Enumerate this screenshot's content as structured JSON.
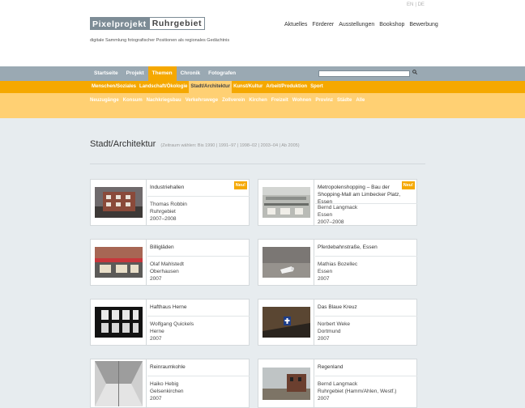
{
  "header": {
    "lang_links": [
      "EN",
      "DE"
    ],
    "logo_part1": "Pixelprojekt",
    "logo_part2": "Ruhrgebiet",
    "tagline": "digitale Sammlung fotografischer Positionen als regionales Gedächtnis",
    "top_nav": [
      "Aktuelles",
      "Förderer",
      "Ausstellungen",
      "Bookshop",
      "Bewerbung"
    ]
  },
  "nav_main": {
    "items": [
      "Startseite",
      "Projekt",
      "Themen",
      "Chronik",
      "Fotografen"
    ],
    "active": "Themen"
  },
  "search": {
    "placeholder": ""
  },
  "nav_themes": {
    "items": [
      "Menschen/Soziales",
      "Landschaft/Ökologie",
      "Stadt/Architektur",
      "Kunst/Kultur",
      "Arbeit/Produktion",
      "Sport"
    ],
    "active": "Stadt/Architektur"
  },
  "nav_tags": [
    "Neuzugänge",
    "Konsum",
    "Nachkriegsbau",
    "Verkehrswege",
    "Zollverein",
    "Kirchen",
    "Freizeit",
    "Wohnen",
    "Provinz",
    "Städte",
    "Alle"
  ],
  "main": {
    "title": "Stadt/Architektur",
    "range": "(Zeitraum wählen: Bis 1990 | 1991–97 | 1998–02 | 2003–04 | Ab 2005)"
  },
  "cards": [
    {
      "title": "Industriehallen",
      "author": "Thomas Robbin",
      "place": "Ruhrgebiet",
      "years": "2007–2008",
      "badge": "Neu!"
    },
    {
      "title": "Metropolenshopping – Bau der Shopping-Mall am Limbecker Platz, Essen",
      "author": "Bernd Langmack",
      "place": "Essen",
      "years": "2007–2008",
      "badge": "Neu!"
    },
    {
      "title": "Billigläden",
      "author": "Olaf Mahlstedt",
      "place": "Oberhausen",
      "years": "2007",
      "badge": ""
    },
    {
      "title": "Pferdebahnstraße, Essen",
      "author": "Mathias Bozellec",
      "place": "Essen",
      "years": "2007",
      "badge": ""
    },
    {
      "title": "Hafthaus Herne",
      "author": "Wolfgang Quickels",
      "place": "Herne",
      "years": "2007",
      "badge": ""
    },
    {
      "title": "Das Blaue Kreuz",
      "author": "Norbert Weke",
      "place": "Dortmund",
      "years": "2007",
      "badge": ""
    },
    {
      "title": "Reinraumkohle",
      "author": "Haiko Hebig",
      "place": "Gelsenkirchen",
      "years": "2007",
      "badge": ""
    },
    {
      "title": "Regenland",
      "author": "Bernd Langmack",
      "place": "Ruhrgebiet (Hamm/Ahlen, Westf.)",
      "years": "2007",
      "badge": ""
    }
  ],
  "colors": {
    "accent": "#f5a800",
    "accent_light": "#ffd073",
    "nav_gray": "#9aa9b3",
    "background": "#e7ecef"
  }
}
